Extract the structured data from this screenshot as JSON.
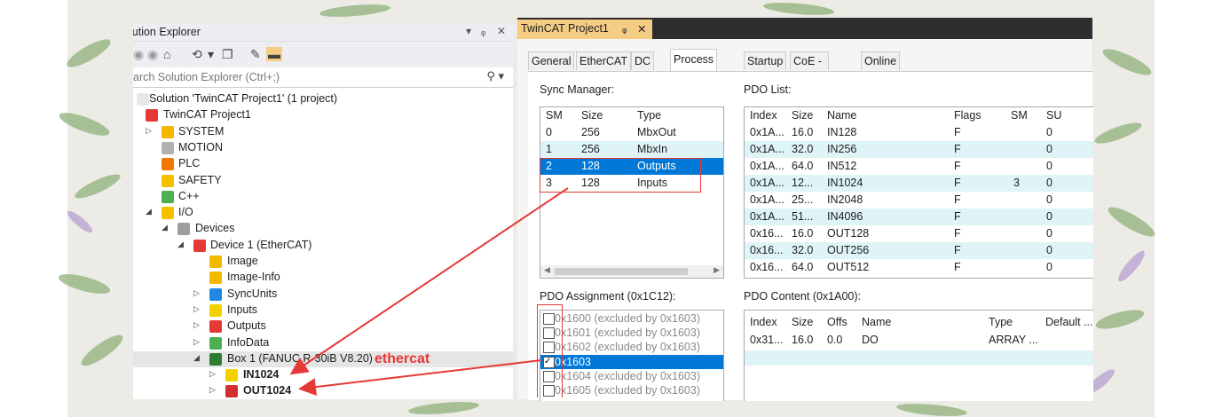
{
  "solution_explorer": {
    "title": "lution Explorer",
    "title_controls": [
      "▾",
      "ᵩ",
      "✕"
    ],
    "search_placeholder": "arch Solution Explorer (Ctrl+;)",
    "tree": [
      {
        "label": "Solution 'TwinCAT Project1' (1 project)",
        "icon": "solution-icon"
      },
      {
        "label": "TwinCAT Project1",
        "icon": "twincat-project-icon"
      },
      {
        "label": "SYSTEM",
        "icon": "system-icon"
      },
      {
        "label": "MOTION",
        "icon": "motion-icon"
      },
      {
        "label": "PLC",
        "icon": "plc-icon"
      },
      {
        "label": "SAFETY",
        "icon": "safety-icon"
      },
      {
        "label": "C++",
        "icon": "cpp-icon"
      },
      {
        "label": "I/O",
        "icon": "io-icon"
      },
      {
        "label": "Devices",
        "icon": "devices-icon"
      },
      {
        "label": "Device 1 (EtherCAT)",
        "icon": "ethercat-device-icon"
      },
      {
        "label": "Image",
        "icon": "image-icon"
      },
      {
        "label": "Image-Info",
        "icon": "image-info-icon"
      },
      {
        "label": "SyncUnits",
        "icon": "syncunits-icon"
      },
      {
        "label": "Inputs",
        "icon": "inputs-icon"
      },
      {
        "label": "Outputs",
        "icon": "outputs-icon"
      },
      {
        "label": "InfoData",
        "icon": "infodata-icon"
      },
      {
        "label": "Box 1 (FANUC R-30iB V8.20)",
        "icon": "box-icon"
      },
      {
        "label": "IN1024",
        "icon": "in-icon"
      },
      {
        "label": "OUT1024",
        "icon": "out-icon"
      }
    ]
  },
  "twincat": {
    "tab_label": "TwinCAT Project1",
    "tab_pin": "ᵩ",
    "tab_close": "✕",
    "inner_tabs": [
      "General",
      "EtherCAT",
      "DC",
      "Process Data",
      "Startup",
      "CoE - Online",
      "Online"
    ],
    "active_inner_tab": "Process Data",
    "sync_manager": {
      "label": "Sync Manager:",
      "headers": [
        "SM",
        "Size",
        "Type"
      ],
      "rows": [
        [
          "0",
          "256",
          "MbxOut"
        ],
        [
          "1",
          "256",
          "MbxIn"
        ],
        [
          "2",
          "128",
          "Outputs"
        ],
        [
          "3",
          "128",
          "Inputs"
        ]
      ]
    },
    "pdo_list": {
      "label": "PDO List:",
      "headers": [
        "Index",
        "Size",
        "Name",
        "Flags",
        "SM",
        "SU"
      ],
      "rows": [
        [
          "0x1A...",
          "16.0",
          "IN128",
          "F",
          "",
          "0"
        ],
        [
          "0x1A...",
          "32.0",
          "IN256",
          "F",
          "",
          "0"
        ],
        [
          "0x1A...",
          "64.0",
          "IN512",
          "F",
          "",
          "0"
        ],
        [
          "0x1A...",
          "12...",
          "IN1024",
          "F",
          "3",
          "0"
        ],
        [
          "0x1A...",
          "25...",
          "IN2048",
          "F",
          "",
          "0"
        ],
        [
          "0x1A...",
          "51...",
          "IN4096",
          "F",
          "",
          "0"
        ],
        [
          "0x16...",
          "16.0",
          "OUT128",
          "F",
          "",
          "0"
        ],
        [
          "0x16...",
          "32.0",
          "OUT256",
          "F",
          "",
          "0"
        ],
        [
          "0x16...",
          "64.0",
          "OUT512",
          "F",
          "",
          "0"
        ]
      ]
    },
    "pdo_assignment": {
      "label": "PDO Assignment (0x1C12):",
      "items": [
        {
          "text": "0x1600 (excluded by 0x1603)",
          "checked": false
        },
        {
          "text": "0x1601 (excluded by 0x1603)",
          "checked": false
        },
        {
          "text": "0x1602 (excluded by 0x1603)",
          "checked": false
        },
        {
          "text": "0x1603",
          "checked": true
        },
        {
          "text": "0x1604 (excluded by 0x1603)",
          "checked": false
        },
        {
          "text": "0x1605 (excluded by 0x1603)",
          "checked": false
        }
      ]
    },
    "pdo_content": {
      "label": "PDO Content (0x1A00):",
      "headers": [
        "Index",
        "Size",
        "Offs",
        "Name",
        "Type",
        "Default ..."
      ],
      "rows": [
        [
          "0x31...",
          "16.0",
          "0.0",
          "DO",
          "ARRAY ...",
          ""
        ]
      ]
    }
  },
  "annotation": "ethercat",
  "colors": {
    "selection": "#0078d7",
    "alt_row": "#dff4f7",
    "annotation_red": "#e53935",
    "tab_yellow": "#f5cc84",
    "dark_tabbar": "#2d2d30"
  }
}
